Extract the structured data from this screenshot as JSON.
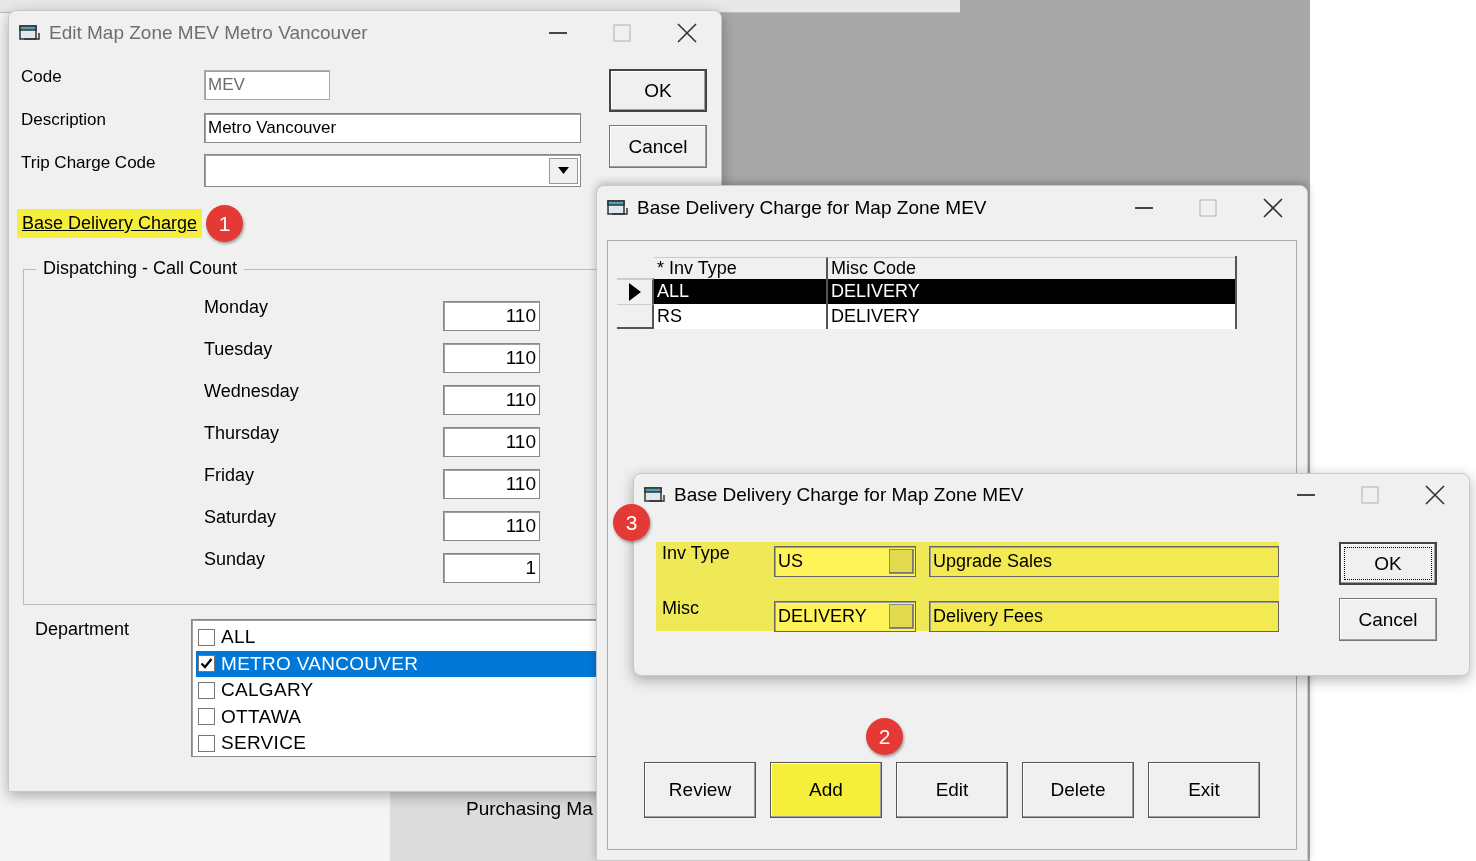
{
  "background": {
    "panel_text": "Purchasing Ma"
  },
  "edit_window": {
    "title": "Edit Map Zone MEV Metro Vancouver",
    "fields": [
      {
        "label": "Code",
        "value": "MEV",
        "disabled": true,
        "kind": "text"
      },
      {
        "label": "Description",
        "value": "Metro Vancouver",
        "kind": "text"
      },
      {
        "label": "Trip Charge Code",
        "kind": "dropdown"
      }
    ],
    "buttons": [
      "OK",
      "Cancel"
    ],
    "link": {
      "label": "Base Delivery Charge",
      "highlighted": true
    },
    "callout": "1",
    "group": {
      "title": "Dispatching  -  Call Count",
      "days": [
        {
          "label": "Monday",
          "value": "110"
        },
        {
          "label": "Tuesday",
          "value": "110"
        },
        {
          "label": "Wednesday",
          "value": "110"
        },
        {
          "label": "Thursday",
          "value": "110"
        },
        {
          "label": "Friday",
          "value": "110"
        },
        {
          "label": "Saturday",
          "value": "110"
        },
        {
          "label": "Sunday",
          "value": "1"
        }
      ]
    },
    "department": {
      "label": "Department",
      "items": [
        {
          "label": "ALL",
          "checked": false,
          "selected": false
        },
        {
          "label": "METRO VANCOUVER",
          "checked": true,
          "selected": true
        },
        {
          "label": "CALGARY",
          "checked": false,
          "selected": false
        },
        {
          "label": "OTTAWA",
          "checked": false,
          "selected": false
        },
        {
          "label": "SERVICE",
          "checked": false,
          "selected": false
        }
      ]
    }
  },
  "grid_window": {
    "title": "Base Delivery Charge for Map Zone MEV",
    "columns": [
      "* Inv Type",
      "Misc Code"
    ],
    "rows": [
      {
        "cells": [
          "ALL",
          "DELIVERY"
        ],
        "selected": true
      },
      {
        "cells": [
          "RS",
          "DELIVERY"
        ],
        "selected": false
      }
    ],
    "callout": "2",
    "buttons": [
      {
        "label": "Review",
        "highlighted": false
      },
      {
        "label": "Add",
        "highlighted": true
      },
      {
        "label": "Edit",
        "highlighted": false
      },
      {
        "label": "Delete",
        "highlighted": false
      },
      {
        "label": "Exit",
        "highlighted": false
      }
    ]
  },
  "detail_window": {
    "title": "Base Delivery Charge for Map Zone MEV",
    "callout": "3",
    "fields": [
      {
        "label": "Inv Type",
        "code": "US",
        "description": "Upgrade Sales"
      },
      {
        "label": "Misc",
        "code": "DELIVERY",
        "description": "Delivery Fees"
      }
    ],
    "highlighted": true,
    "buttons": [
      {
        "label": "OK",
        "default": true
      },
      {
        "label": "Cancel",
        "default": false
      }
    ]
  }
}
